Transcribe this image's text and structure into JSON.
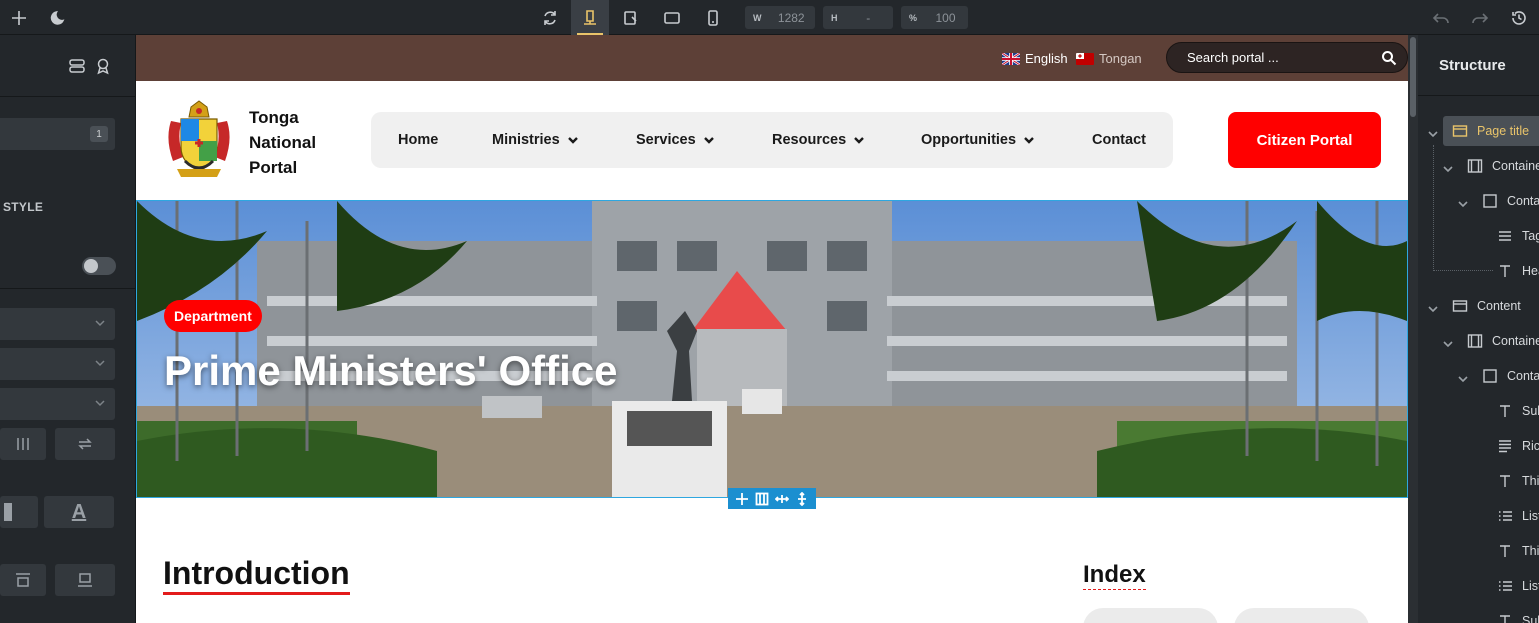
{
  "toolbar": {
    "width_label": "W",
    "width_value": "1282",
    "height_label": "H",
    "height_value": "-",
    "zoom_label": "%",
    "zoom_value": "100",
    "icons": [
      "plus-icon",
      "moon-icon",
      "refresh-icon",
      "desktop-breakpoint-icon",
      "tablet-landscape-icon",
      "tablet-icon",
      "mobile-icon",
      "undo-icon",
      "redo-icon",
      "history-icon"
    ]
  },
  "left_panel": {
    "count_badge": "1",
    "style_label": "STYLE"
  },
  "site": {
    "languages": [
      {
        "label": "English",
        "flag": "uk-flag-icon"
      },
      {
        "label": "Tongan",
        "flag": "tonga-flag-icon"
      }
    ],
    "search_placeholder": "Search portal ...",
    "brand_lines": [
      "Tonga",
      "National",
      "Portal"
    ],
    "nav": [
      {
        "label": "Home",
        "dropdown": false
      },
      {
        "label": "Ministries",
        "dropdown": true
      },
      {
        "label": "Services",
        "dropdown": true
      },
      {
        "label": "Resources",
        "dropdown": true
      },
      {
        "label": "Opportunities",
        "dropdown": true
      },
      {
        "label": "Contact",
        "dropdown": false
      }
    ],
    "cta_label": "Citizen Portal",
    "hero": {
      "badge": "Department",
      "title": "Prime Ministers' Office"
    },
    "intro_heading": "Introduction",
    "index_heading": "Index"
  },
  "structure": {
    "title": "Structure",
    "items": [
      {
        "label": "Page title",
        "icon": "section-icon",
        "selected": true
      },
      {
        "label": "Container",
        "icon": "container-icon"
      },
      {
        "label": "Container",
        "icon": "block-icon"
      },
      {
        "label": "Tag",
        "icon": "text-lines-icon"
      },
      {
        "label": "Heading",
        "icon": "heading-icon"
      },
      {
        "label": "Content",
        "icon": "section-icon"
      },
      {
        "label": "Container",
        "icon": "container-icon"
      },
      {
        "label": "Container",
        "icon": "block-icon"
      },
      {
        "label": "Subheading",
        "icon": "heading-icon"
      },
      {
        "label": "Rich text",
        "icon": "rich-text-icon"
      },
      {
        "label": "Third heading",
        "icon": "heading-icon"
      },
      {
        "label": "List",
        "icon": "list-icon"
      },
      {
        "label": "Third heading",
        "icon": "heading-icon"
      },
      {
        "label": "List",
        "icon": "list-icon"
      },
      {
        "label": "Subheading",
        "icon": "heading-icon"
      }
    ]
  },
  "colors": {
    "util_bar": "#5d4037",
    "cta": "#ff0000",
    "accent_editor": "#e9c46a",
    "selection": "#1b8fd0"
  }
}
